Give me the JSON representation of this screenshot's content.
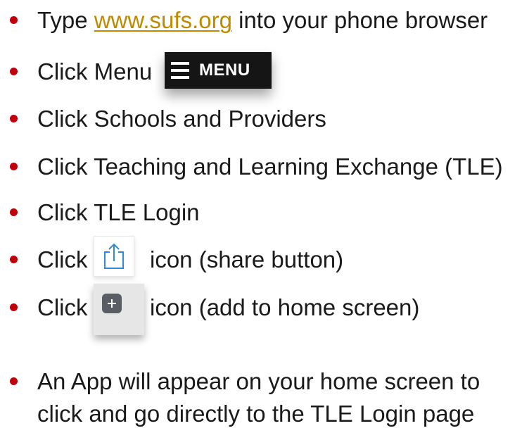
{
  "instructions": {
    "step1": {
      "before": "Type ",
      "link": "www.sufs.org",
      "after": " into your phone browser"
    },
    "step2": {
      "text": "Click Menu",
      "menu_button_label": "MENU",
      "menu_icon": "hamburger-icon"
    },
    "step3": {
      "text": "Click Schools and Providers"
    },
    "step4": {
      "text": "Click Teaching and Learning Exchange (TLE)"
    },
    "step5": {
      "text": "Click TLE Login"
    },
    "step6": {
      "before": "Click",
      "icon": "share-icon",
      "after": "icon (share button)"
    },
    "step7": {
      "before": "Click",
      "icon": "add-to-home-screen-icon",
      "after": "icon (add to home screen)"
    },
    "step8": {
      "line1": "An App will appear on your home screen to",
      "line2": "click and go directly to the TLE Login page"
    }
  },
  "colors": {
    "bullet": "#c0000a",
    "link": "#c08a00",
    "menu_button_bg": "#151515",
    "share_icon": "#2f8bd6",
    "add_icon_bg": "#5a5e64"
  }
}
